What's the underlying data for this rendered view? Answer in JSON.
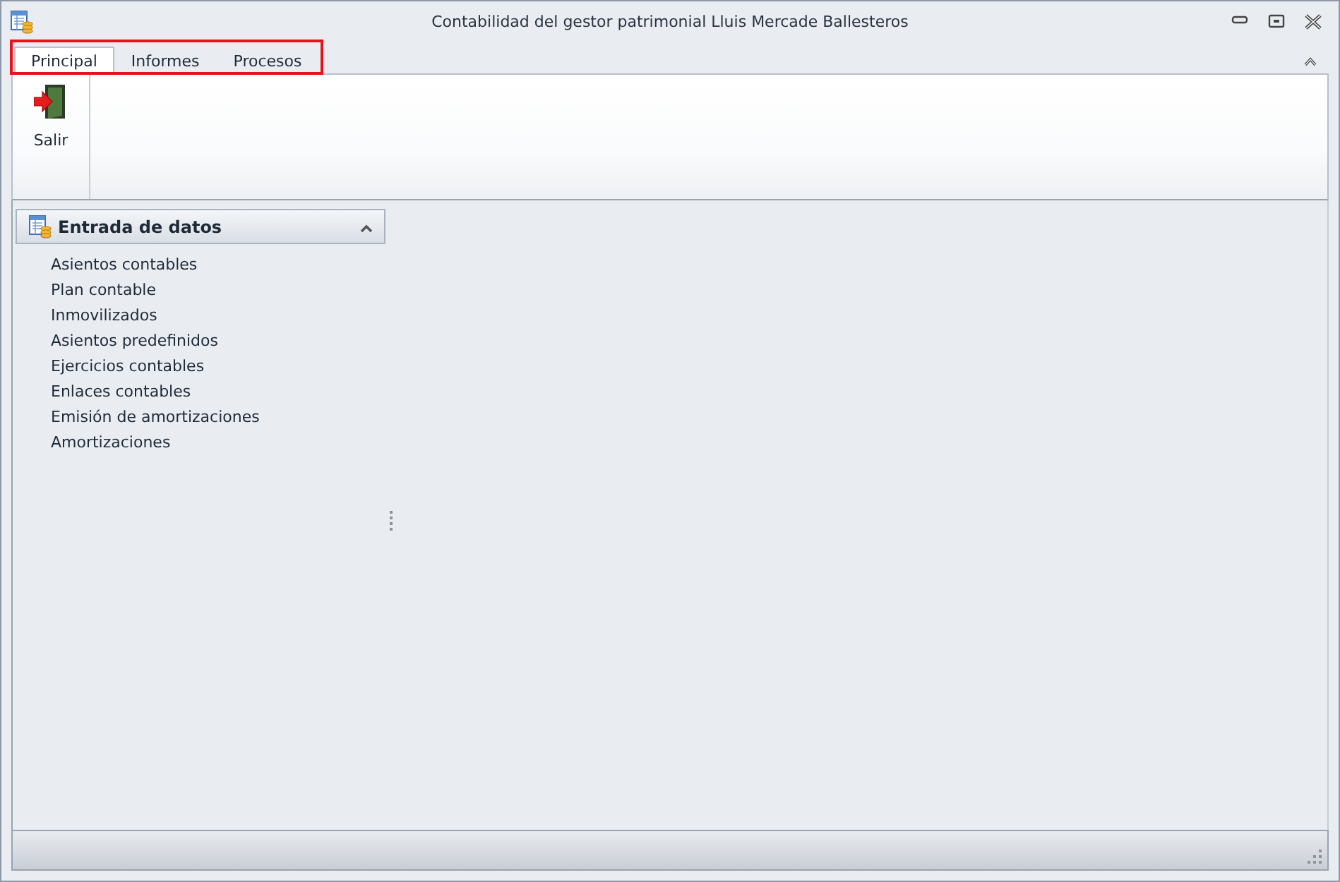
{
  "window": {
    "title": "Contabilidad del gestor patrimonial Lluis Mercade Ballesteros"
  },
  "ribbon": {
    "tabs_highlighted": true,
    "tabs": [
      {
        "label": "Principal",
        "selected": true
      },
      {
        "label": "Informes",
        "selected": false
      },
      {
        "label": "Procesos",
        "selected": false
      }
    ],
    "buttons": [
      {
        "label": "Salir"
      }
    ]
  },
  "nav_group": {
    "title": "Entrada de datos",
    "expanded": true,
    "items": [
      {
        "label": "Asientos contables"
      },
      {
        "label": "Plan contable"
      },
      {
        "label": "Inmovilizados"
      },
      {
        "label": "Asientos predefinidos"
      },
      {
        "label": "Ejercicios contables"
      },
      {
        "label": "Enlaces contables"
      },
      {
        "label": "Emisión de amortizaciones"
      },
      {
        "label": "Amortizaciones"
      }
    ]
  }
}
